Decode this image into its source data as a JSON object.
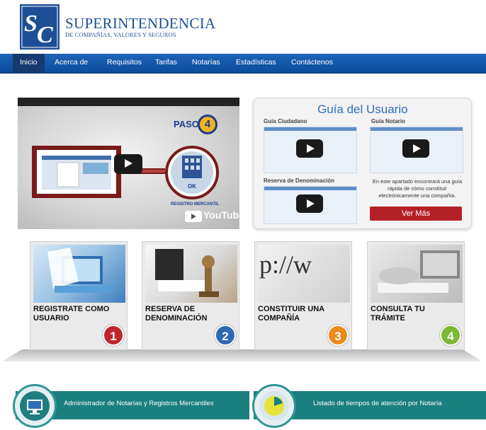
{
  "header": {
    "logo_initials": "SC",
    "org_title": "SUPERINTENDENCIA",
    "org_subtitle": "DE COMPAÑÍAS, VALORES Y SEGUROS"
  },
  "nav": {
    "items": [
      "Inicio",
      "Acerca de",
      "Requisitos",
      "Tarifas",
      "Notarías",
      "Estadísticas",
      "Contáctenos"
    ],
    "active": "Inicio"
  },
  "video": {
    "step_label": "PASO",
    "step_number": "4",
    "badge_ok": "OK",
    "badge_caption": "REGISTRO MERCANTIL",
    "platform": "YouTube"
  },
  "guide": {
    "title": "Guía del Usuario",
    "labels": [
      "Guía Ciudadano",
      "Guía Notario",
      "Reserva de Denominación"
    ],
    "description": "En este apartado encontrará una guía rápida de cómo constituir electrónicamente una compañía.",
    "button": "Ver Más"
  },
  "steps": [
    {
      "label": "REGISTRATE COMO USUARIO",
      "number": "1",
      "color": "#c0272d"
    },
    {
      "label": "RESERVA DE DENOMINACIÓN",
      "number": "2",
      "color": "#2e69b3"
    },
    {
      "label": "CONSTITUIR UNA COMPAÑÍA",
      "number": "3",
      "color": "#ee8a1d"
    },
    {
      "label": "CONSULTA TU TRÁMITE",
      "number": "4",
      "color": "#7cb833"
    }
  ],
  "bottom": {
    "left": "Administrador de Notarías y Registros Mercantiles",
    "right": "Listado de tiempos de atención por Notaría"
  },
  "colors": {
    "brand_blue": "#1d4f96",
    "nav_blue": "#0c4c9c",
    "teal": "#1b7f7e",
    "button_red": "#b42026"
  }
}
